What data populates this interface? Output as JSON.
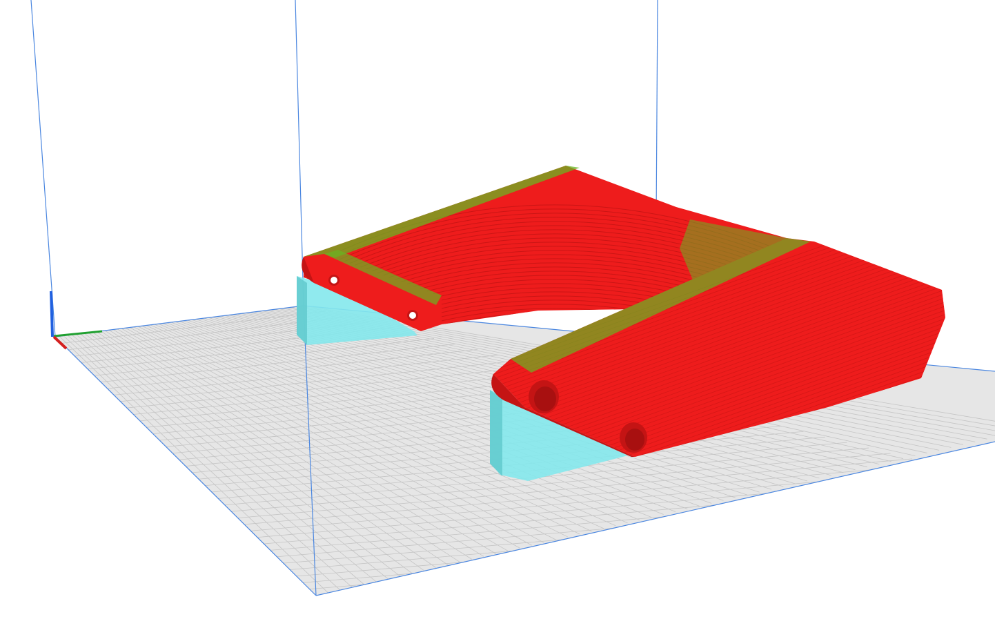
{
  "viewport": {
    "background_color": "#ffffff",
    "build_plate_color": "#e6e6e6",
    "grid_line_color": "#c4c4c4",
    "volume_edge_color": "#4a86e0"
  },
  "axes": {
    "x_axis_color": "#d42020",
    "y_axis_color": "#20a030",
    "z_axis_color": "#2060e0"
  },
  "model": {
    "wall_color": "#ee1c1c",
    "shade_color": "#c41414",
    "infill_color": "#6ab422",
    "support_color": "#84e8ec"
  }
}
